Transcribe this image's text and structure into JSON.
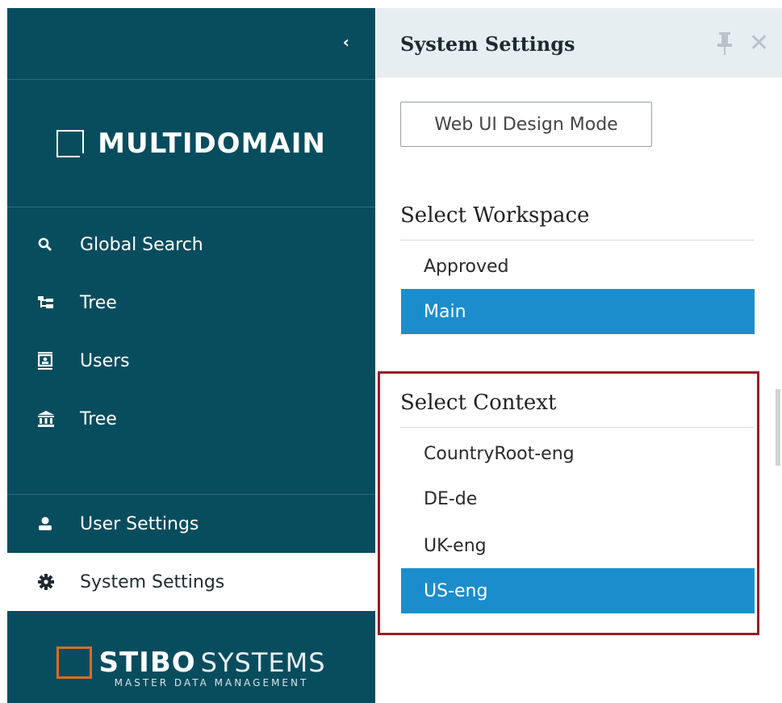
{
  "sidebar": {
    "collapse_icon": "chevron-left-icon",
    "logo_text": "MULTIDOMAIN",
    "nav": [
      {
        "label": "Global Search",
        "icon": "search-icon"
      },
      {
        "label": "Tree",
        "icon": "tree-icon"
      },
      {
        "label": "Users",
        "icon": "users-icon"
      },
      {
        "label": "Tree",
        "icon": "bank-icon"
      }
    ],
    "bottom_nav": [
      {
        "label": "User Settings",
        "icon": "user-icon"
      },
      {
        "label": "System Settings",
        "icon": "gear-icon",
        "active": true
      }
    ],
    "brand": {
      "stibo": "STIBO",
      "systems": "SYSTEMS",
      "tagline": "MASTER DATA MANAGEMENT"
    }
  },
  "panel": {
    "title": "System Settings",
    "design_mode_label": "Web UI Design Mode",
    "workspace": {
      "title": "Select Workspace",
      "options": [
        "Approved",
        "Main"
      ],
      "selected": "Main"
    },
    "context": {
      "title": "Select Context",
      "options": [
        "CountryRoot-eng",
        "DE-de",
        "UK-eng",
        "US-eng"
      ],
      "selected": "US-eng"
    }
  },
  "colors": {
    "sidebar_bg": "#084d5e",
    "selected_bg": "#1b8dcd",
    "brand_orange": "#e06a20",
    "highlight_border": "#9b1c25"
  }
}
